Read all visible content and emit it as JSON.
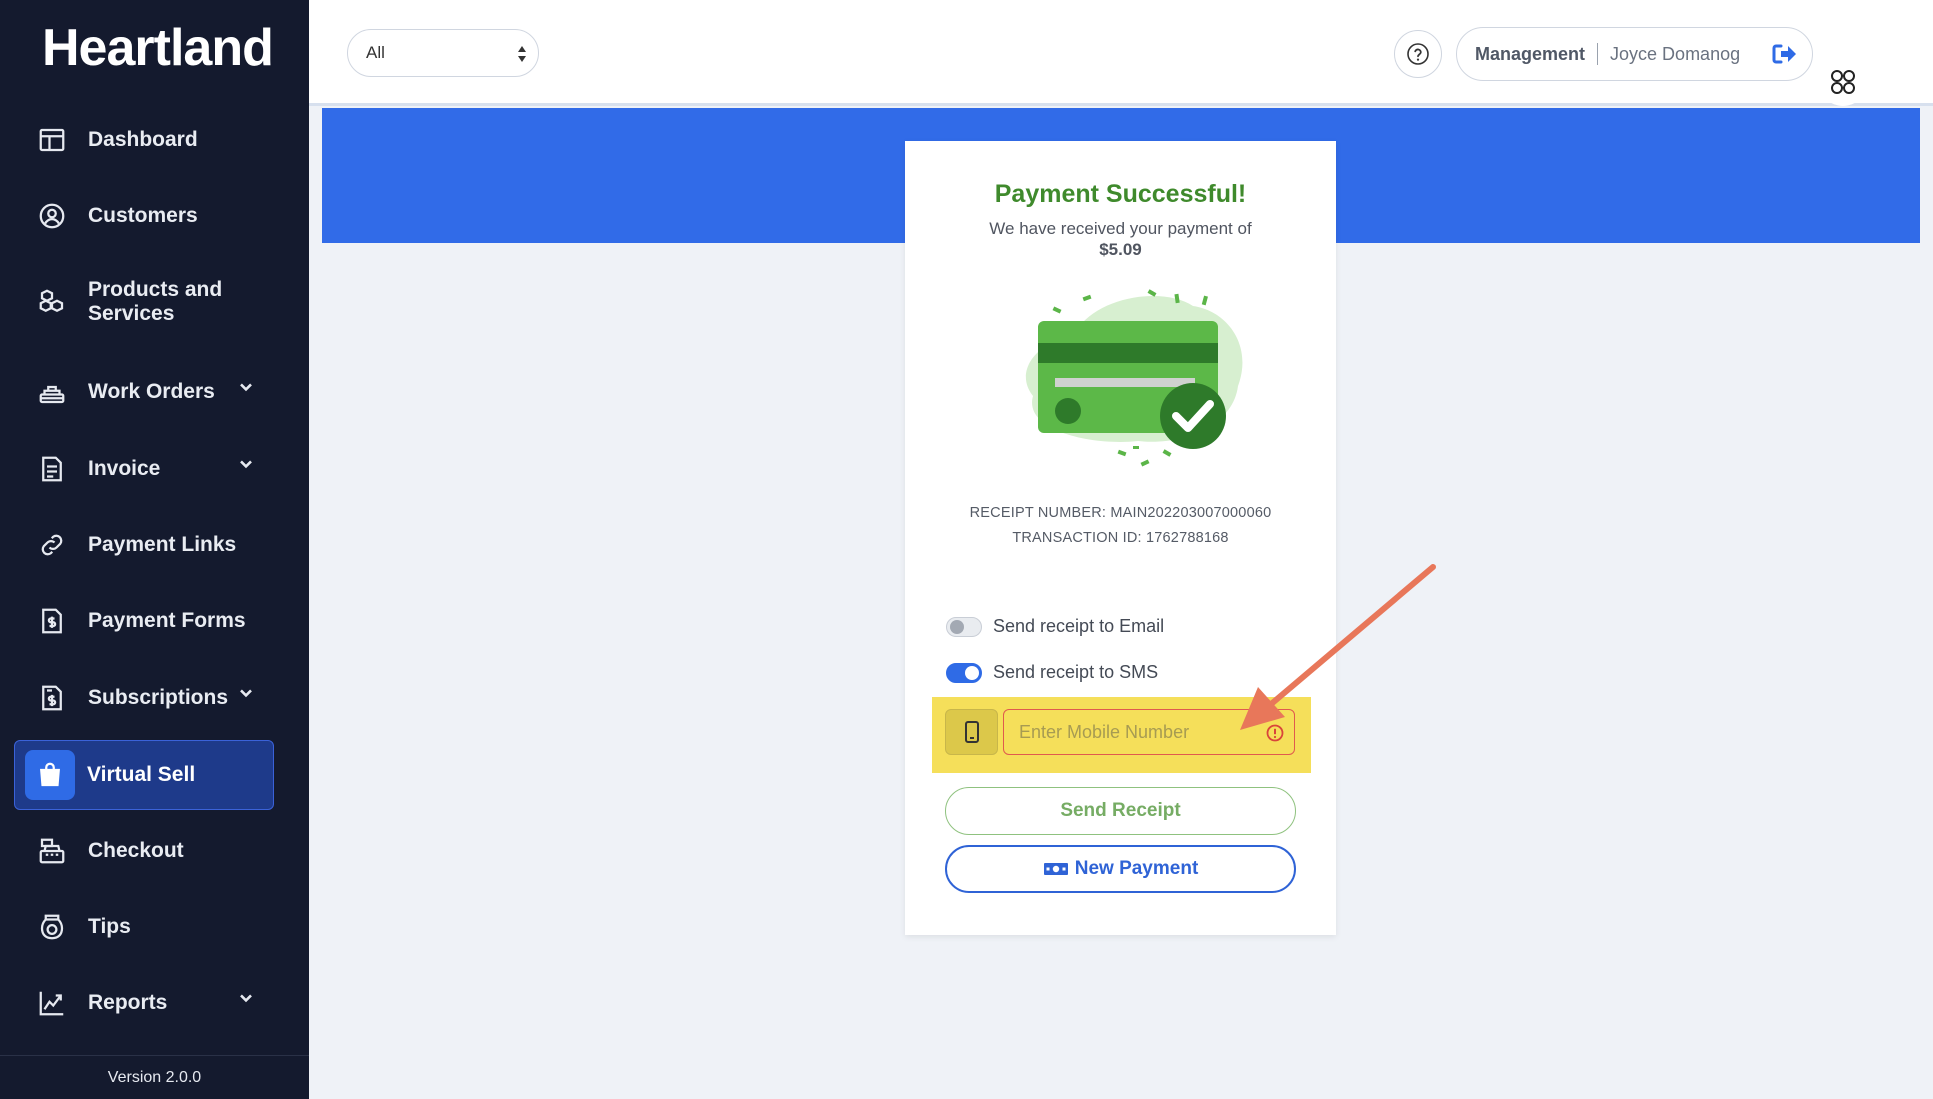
{
  "sidebar": {
    "logo": "Heartland",
    "items": [
      {
        "label": "Dashboard",
        "icon": "dashboard-icon"
      },
      {
        "label": "Customers",
        "icon": "customers-icon"
      },
      {
        "label": "Products and Services",
        "icon": "products-icon"
      },
      {
        "label": "Work Orders",
        "icon": "work-orders-icon",
        "expandable": true
      },
      {
        "label": "Invoice",
        "icon": "invoice-icon",
        "expandable": true
      },
      {
        "label": "Payment Links",
        "icon": "link-icon"
      },
      {
        "label": "Payment Forms",
        "icon": "payment-forms-icon"
      },
      {
        "label": "Subscriptions",
        "icon": "subscriptions-icon",
        "expandable": true
      },
      {
        "label": "Virtual Sell",
        "icon": "shopping-bag-icon",
        "active": true
      },
      {
        "label": "Checkout",
        "icon": "register-icon"
      },
      {
        "label": "Tips",
        "icon": "tip-jar-icon"
      },
      {
        "label": "Reports",
        "icon": "reports-icon",
        "expandable": true
      }
    ],
    "version": "Version 2.0.0"
  },
  "topbar": {
    "location_select": "All",
    "role": "Management",
    "user_name": "Joyce Domanog"
  },
  "payment": {
    "title": "Payment Successful!",
    "message": "We have received your payment of",
    "amount": "$5.09",
    "receipt_number": "RECEIPT NUMBER: MAIN202203007000060",
    "transaction_id": "TRANSACTION ID: 1762788168",
    "email_toggle_label": "Send receipt to Email",
    "email_toggle_on": false,
    "sms_toggle_label": "Send receipt to SMS",
    "sms_toggle_on": true,
    "mobile_placeholder": "Enter Mobile Number",
    "mobile_value": "",
    "send_receipt_label": "Send Receipt",
    "new_payment_label": "New Payment"
  },
  "colors": {
    "sidebar_bg": "#141a2e",
    "banner": "#316be8",
    "success_green": "#3f8a2c",
    "highlight": "#f5df5a",
    "annotation_arrow": "#e8775a"
  }
}
